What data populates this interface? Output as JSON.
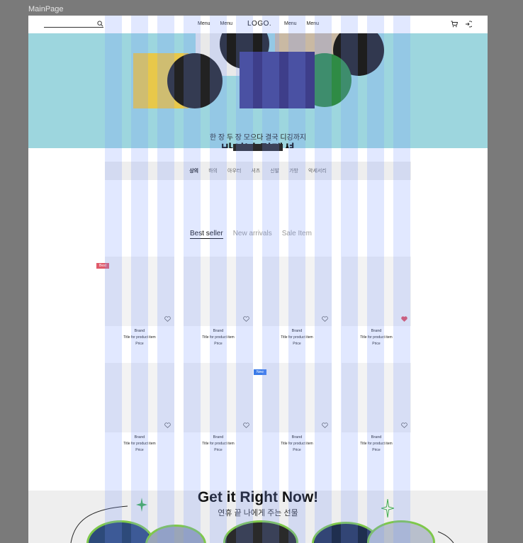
{
  "frame": {
    "label": "MainPage"
  },
  "header": {
    "logo": "LOGO.",
    "nav_left": [
      "Menu",
      "Menu"
    ],
    "nav_right": [
      "Menu",
      "Menu"
    ],
    "icons": {
      "search": "search-icon",
      "cart": "cart-icon",
      "login": "login-icon"
    }
  },
  "banner": {
    "subtitle": "한 장 두 장 모으다 결국 디깅까지",
    "title": "바이닐 컬렉션",
    "bg_color": "#9dd6de"
  },
  "categories": {
    "items": [
      "상의",
      "하의",
      "아우터",
      "셔츠",
      "신발",
      "가방",
      "악세서리"
    ],
    "active_index": 0
  },
  "tabs": {
    "items": [
      "Best seller",
      "New arrivals",
      "Sale Item"
    ],
    "active_index": 0
  },
  "products": [
    {
      "brand": "Brand",
      "title": "Title for product item",
      "price": "Price",
      "badge": "Best",
      "badge_color": "#e05a6a",
      "liked": false
    },
    {
      "brand": "Brand",
      "title": "Title for product item",
      "price": "Price",
      "badge": "",
      "liked": false
    },
    {
      "brand": "Brand",
      "title": "Title for product item",
      "price": "Price",
      "badge": "",
      "liked": false
    },
    {
      "brand": "Brand",
      "title": "Title for product item",
      "price": "Price",
      "badge": "",
      "liked": true
    },
    {
      "brand": "Brand",
      "title": "Title for product item",
      "price": "Price",
      "badge": "",
      "liked": false
    },
    {
      "brand": "Brand",
      "title": "Title for product item",
      "price": "Price",
      "badge": "",
      "liked": false
    },
    {
      "brand": "Brand",
      "title": "Title for product item",
      "price": "Price",
      "badge": "New",
      "badge_color": "#3b7be8",
      "liked": false
    },
    {
      "brand": "Brand",
      "title": "Title for product item",
      "price": "Price",
      "badge": "",
      "liked": false
    }
  ],
  "promo": {
    "title": "Get it Right Now!",
    "subtitle": "연휴 끝 나에게 주는 선물"
  },
  "colors": {
    "like_active": "#e0505e",
    "accent": "#3b7be8"
  }
}
